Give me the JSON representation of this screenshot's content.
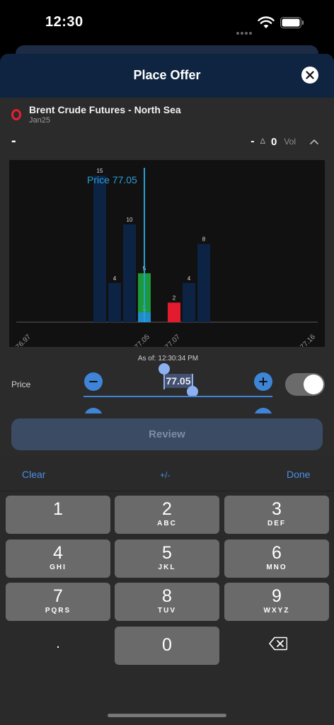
{
  "status": {
    "time": "12:30"
  },
  "sheet": {
    "title": "Place Offer"
  },
  "instrument": {
    "name": "Brent Crude Futures - North Sea",
    "contract": "Jan25"
  },
  "quote": {
    "last": "-",
    "change": "-",
    "delta_symbol": "Δ",
    "volume": "0",
    "vol_label": "Vol"
  },
  "chart_data": {
    "type": "bar",
    "annotation": "Price 77.05",
    "x_ticks": [
      "76.97",
      "77.05",
      "77.07",
      "77.16"
    ],
    "bars": [
      {
        "series": "bid",
        "value": 15,
        "label": "15"
      },
      {
        "series": "bid",
        "value": 4,
        "label": "4"
      },
      {
        "series": "bid",
        "value": 10,
        "label": "10"
      },
      {
        "series": "highlight",
        "value": 5,
        "label": "5",
        "sub_value": 1,
        "sub_label": "1"
      },
      {
        "series": "offer",
        "value": 2,
        "label": "2"
      },
      {
        "series": "bid",
        "value": 4,
        "label": "4"
      },
      {
        "series": "bid",
        "value": 8,
        "label": "8"
      }
    ],
    "colors": {
      "bid": "#0d2343",
      "highlight": "#1c9a3a",
      "sub": "#1f8ccc",
      "offer": "#e31b2f",
      "price_line": "#2a9fd6"
    }
  },
  "asof": {
    "label": "As of:",
    "time": "12:30:34 PM"
  },
  "price": {
    "label": "Price",
    "value": "77.05"
  },
  "review": {
    "label": "Review"
  },
  "accessory": {
    "clear": "Clear",
    "plus_minus": "+/-",
    "done": "Done"
  },
  "keypad": [
    {
      "digit": "1",
      "letters": ""
    },
    {
      "digit": "2",
      "letters": "ABC"
    },
    {
      "digit": "3",
      "letters": "DEF"
    },
    {
      "digit": "4",
      "letters": "GHI"
    },
    {
      "digit": "5",
      "letters": "JKL"
    },
    {
      "digit": "6",
      "letters": "MNO"
    },
    {
      "digit": "7",
      "letters": "PQRS"
    },
    {
      "digit": "8",
      "letters": "TUV"
    },
    {
      "digit": "9",
      "letters": "WXYZ"
    },
    {
      "digit": "0",
      "letters": ""
    }
  ],
  "keypad_dot": "."
}
